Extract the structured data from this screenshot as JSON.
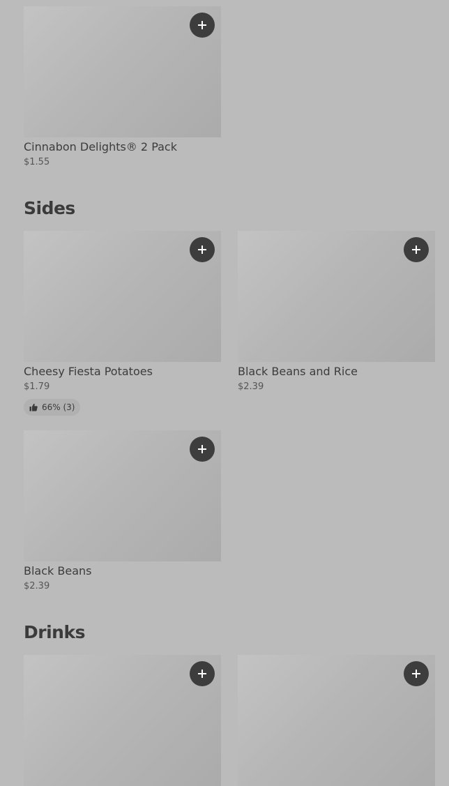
{
  "items": {
    "cinnabon": {
      "name": "Cinnabon Delights® 2 Pack",
      "price": "$1.55"
    },
    "cheesy_fiesta": {
      "name": "Cheesy Fiesta Potatoes",
      "price": "$1.79",
      "rating": "66% (3)"
    },
    "black_beans_rice": {
      "name": "Black Beans and Rice",
      "price": "$2.39"
    },
    "black_beans": {
      "name": "Black Beans",
      "price": "$2.39"
    }
  },
  "sections": {
    "sides": {
      "title": "Sides"
    },
    "drinks": {
      "title": "Drinks"
    }
  },
  "icons": {
    "add": "plus-icon",
    "rating": "thumbs-up-icon"
  },
  "colors": {
    "background": "#bbbbbb",
    "add_button": "#3d3d3d",
    "text": "#3c3c3c"
  }
}
